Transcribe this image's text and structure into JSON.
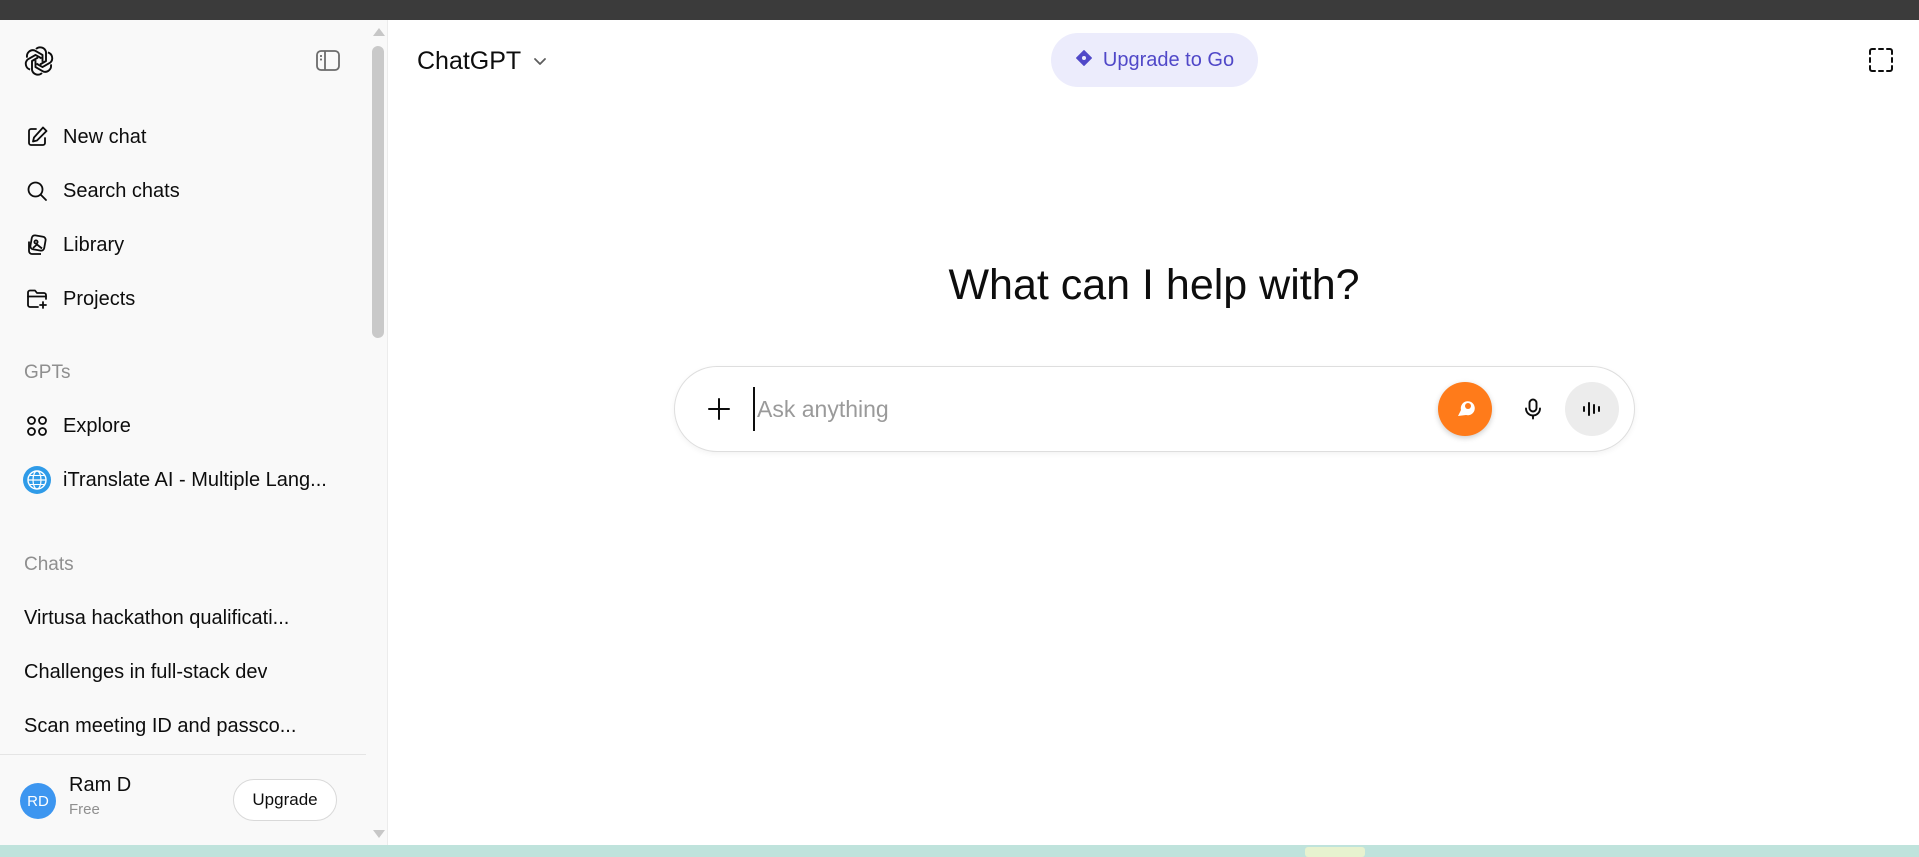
{
  "app": {
    "title": "ChatGPT"
  },
  "sidebar": {
    "nav": [
      {
        "label": "New chat",
        "icon": "compose-icon"
      },
      {
        "label": "Search chats",
        "icon": "search-icon"
      },
      {
        "label": "Library",
        "icon": "library-icon"
      },
      {
        "label": "Projects",
        "icon": "folder-plus-icon"
      }
    ],
    "gpts_label": "GPTs",
    "gpts": [
      {
        "label": "Explore",
        "icon": "grid-icon"
      },
      {
        "label": "iTranslate AI - Multiple Lang...",
        "icon": "globe-icon"
      }
    ],
    "chats_label": "Chats",
    "chats": [
      {
        "label": "Virtusa hackathon qualificati..."
      },
      {
        "label": "Challenges in full-stack dev"
      },
      {
        "label": "Scan meeting ID and passco..."
      }
    ],
    "user": {
      "initials": "RD",
      "name": "Ram D",
      "plan": "Free",
      "upgrade_label": "Upgrade"
    }
  },
  "header": {
    "model_label": "ChatGPT",
    "upgrade_pill_label": "Upgrade to Go"
  },
  "main": {
    "headline": "What can I help with?",
    "composer": {
      "placeholder": "Ask anything"
    }
  },
  "colors": {
    "accent_orange": "#ff7b1a",
    "upgrade_pill_bg": "#ececfc",
    "upgrade_pill_text": "#5048c8",
    "avatar_bg": "#3d96f0"
  }
}
